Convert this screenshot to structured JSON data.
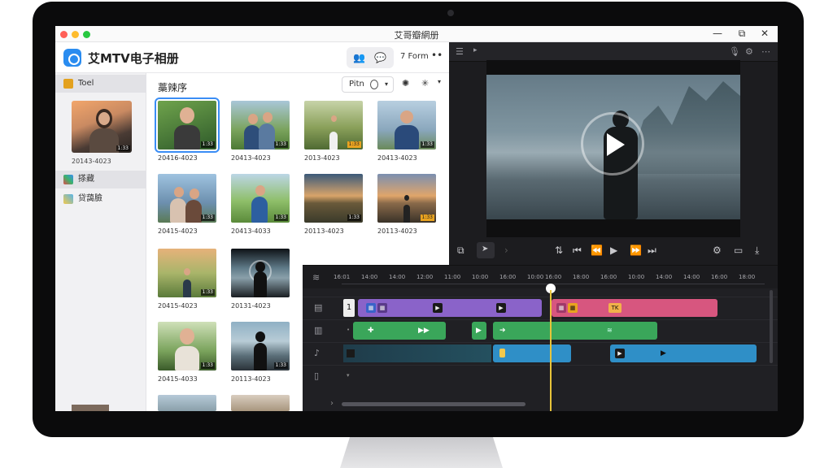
{
  "window": {
    "title": "艾哥瓣網册",
    "minimize": "—",
    "maximize": "⧉",
    "close": "✕"
  },
  "header": {
    "app_name": "艾MTV电子相册",
    "view_label": "7 Form",
    "more": "••"
  },
  "sidebar": {
    "items": [
      {
        "label": "Toel"
      },
      {
        "label": "搽藏"
      },
      {
        "label": "贷藹臉"
      }
    ],
    "album_date": "20143-4023"
  },
  "content": {
    "title": "藁辣序",
    "filter_label": "Pitn",
    "pager": "• • •",
    "photos": [
      {
        "date": "20416-4023",
        "badge": "1:33"
      },
      {
        "date": "20413-4023",
        "badge": "1:33"
      },
      {
        "date": "2013-4023",
        "badge": "1:33"
      },
      {
        "date": "20413-4023",
        "badge": "1:33"
      },
      {
        "date": "20415-4023",
        "badge": "1:33"
      },
      {
        "date": "20413-4033",
        "badge": "1:33"
      },
      {
        "date": "20113-4023",
        "badge": "1:33"
      },
      {
        "date": "20113-4023",
        "badge": "1:33"
      },
      {
        "date": "20415-4023",
        "badge": "1:33"
      },
      {
        "date": "20131-4023",
        "badge": "1:33"
      },
      {
        "date": "20415-4033",
        "badge": "1:33"
      },
      {
        "date": "20113-4023",
        "badge": "1:33"
      }
    ]
  },
  "timeline": {
    "ticks": [
      "16:01",
      "14:00",
      "14:00",
      "12:00",
      "11:00",
      "10:00",
      "16:00",
      "10:00",
      "16:00",
      "18:00",
      "16:00",
      "10:00",
      "14:00",
      "14:00",
      "16:00",
      "18:00"
    ],
    "track_number": "1",
    "clip_labels": {
      "purple_a": "▶",
      "purple_b": "▶",
      "pink_a": "TK",
      "green_a": "✚",
      "green_b": "▶▶",
      "green_c": "▶",
      "green_d": "➔",
      "blue_a": "▶",
      "blue_b": "▶"
    }
  },
  "colors": {
    "accent": "#3a8df5",
    "clip_purple": "#8a63c9",
    "clip_pink": "#d7567f",
    "clip_green": "#3aa65a",
    "clip_blue": "#2f8fc7",
    "playhead": "#e8c43a"
  }
}
